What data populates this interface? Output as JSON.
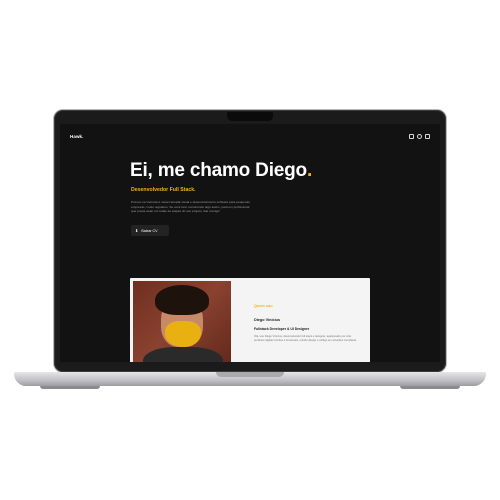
{
  "nav": {
    "brand": "Hawk.",
    "social_icons": [
      "linkedin-icon",
      "github-icon",
      "instagram-icon"
    ]
  },
  "hero": {
    "title": "Ei, me chamo Diego",
    "title_dot": ".",
    "subtitle": "Desenvolvedor Full Stack.",
    "description": "Possuo na vivência é usual camada visual e desenvolvimento software para pequenas empresas, muito regulares. Se você tiver construindo algo assim, para um profissional que possa atuar em todas as etapas do seu projeto, fale comigo!",
    "cv_button": "Baixar CV"
  },
  "about": {
    "label": "Quem sou",
    "name": "Diego Vinícius",
    "role": "Fullstack Developer & UI Designer",
    "description": "Olá, sou Diego Vinícius, desenvolvedor full stack e designer, apaixonado por criar produtos digitais bonitos e funcionais, unindo design e código em soluções completas."
  },
  "colors": {
    "accent": "#f5b50a",
    "screen_bg": "#121212",
    "card_bg": "#f4f4f5"
  }
}
